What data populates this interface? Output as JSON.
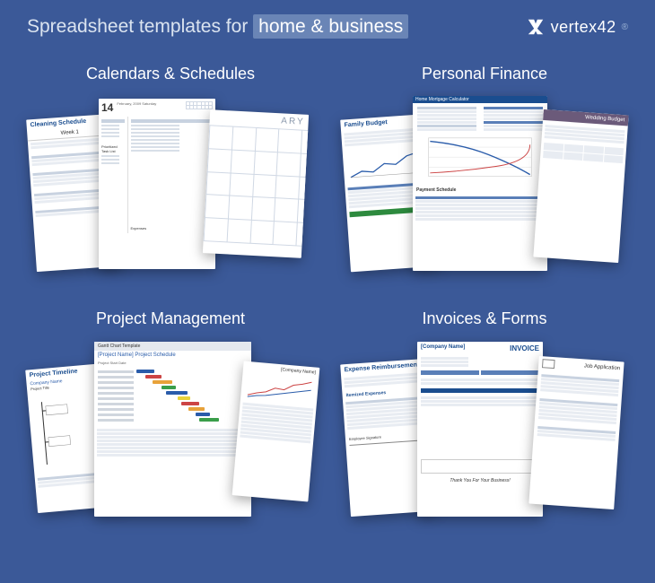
{
  "header": {
    "tagline_prefix": "Spreadsheet templates for",
    "tagline_highlight": "home & business",
    "logo_text": "vertex42",
    "logo_reg": "®"
  },
  "categories": [
    {
      "title": "Calendars & Schedules",
      "sheets": [
        {
          "title": "Cleaning Schedule",
          "subtitle": "Week 1"
        },
        {
          "title": "14",
          "subtitle": "February, 2009 Saturday",
          "label": "Prioritized Task List",
          "footer": "Expenses"
        },
        {
          "title": "ARY"
        }
      ]
    },
    {
      "title": "Personal Finance",
      "sheets": [
        {
          "title": "Family Budget"
        },
        {
          "title": "Home Mortgage Calculator",
          "label": "Payment Schedule"
        },
        {
          "title": "Wedding Budget"
        }
      ]
    },
    {
      "title": "Project Management",
      "sheets": [
        {
          "title": "Project Timeline",
          "subtitle": "Company Name",
          "label": "Project Title"
        },
        {
          "title": "Gantt Chart Template",
          "subtitle": "[Project Name] Project Schedule",
          "label": "Project Start Date"
        },
        {
          "title": "[Company Name]"
        }
      ]
    },
    {
      "title": "Invoices & Forms",
      "sheets": [
        {
          "title": "Expense Reimbursement",
          "label": "Itemized Expenses",
          "footer": "Employee Signature"
        },
        {
          "title": "[Company Name]",
          "subtitle": "INVOICE",
          "footer": "Thank You For Your Business!"
        },
        {
          "title": "Job Application"
        }
      ]
    }
  ]
}
